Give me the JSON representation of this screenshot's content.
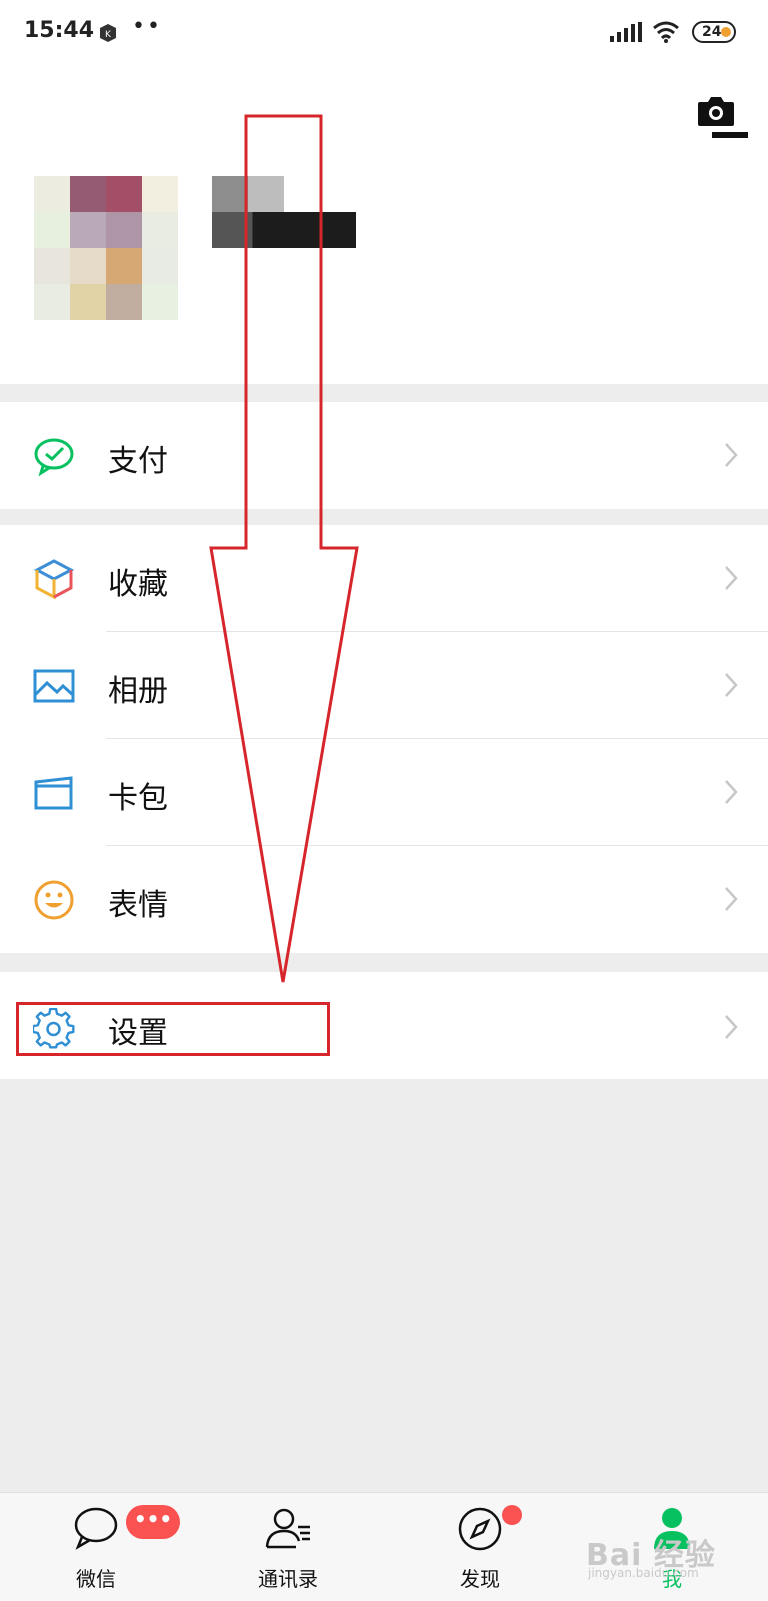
{
  "status_bar": {
    "time": "15:44",
    "dots": "••",
    "battery_level": "24"
  },
  "profile": {
    "camera_icon": "camera-icon",
    "avatar_colors": [
      "#ecece0",
      "#955b72",
      "#a24f67",
      "#f3efe0",
      "#e7efdf",
      "#baa9b6",
      "#ae96a6",
      "#e9ede1",
      "#e7e5dc",
      "#e6dac8",
      "#d6a873",
      "#e7ebe3",
      "#e8ece3",
      "#e2d3a7",
      "#c0ada0",
      "#e8f0e2"
    ]
  },
  "menu": {
    "pay": {
      "label": "支付",
      "icon": "wechat-pay-icon"
    },
    "favorites": {
      "label": "收藏",
      "icon": "cube-icon"
    },
    "album": {
      "label": "相册",
      "icon": "picture-icon"
    },
    "cards": {
      "label": "卡包",
      "icon": "card-icon"
    },
    "stickers": {
      "label": "表情",
      "icon": "smiley-icon"
    },
    "settings": {
      "label": "设置",
      "icon": "gear-icon"
    }
  },
  "tabbar": {
    "chats": {
      "label": "微信",
      "badge": "•••"
    },
    "contacts": {
      "label": "通讯录"
    },
    "discover": {
      "label": "发现"
    },
    "me": {
      "label": "我"
    }
  },
  "watermark": {
    "text": "Bai 经验",
    "sub": "jingyan.baidu.com"
  },
  "colors": {
    "accent_green": "#07c160",
    "annotation_red": "#d7262b",
    "badge_red": "#fa5151"
  }
}
